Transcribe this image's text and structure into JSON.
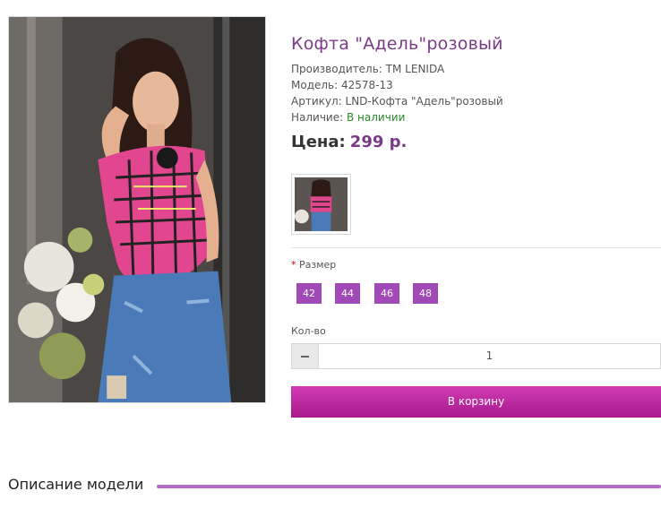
{
  "product": {
    "title": "Кофта \"Адель\"розовый",
    "manufacturer_label": "Производитель:",
    "manufacturer_value": "TM LENIDA",
    "model_label": "Модель:",
    "model_value": "42578-13",
    "sku_label": "Артикул:",
    "sku_value": "LND-Кофта \"Адель\"розовый",
    "availability_label": "Наличие:",
    "availability_value": "В наличии",
    "price_label": "Цена:",
    "price_value": "299 р."
  },
  "options": {
    "size_required_mark": "*",
    "size_label": "Размер",
    "sizes": [
      "42",
      "44",
      "46",
      "48"
    ]
  },
  "quantity": {
    "label": "Кол-во",
    "value": "1"
  },
  "cart": {
    "button_label": "В корзину"
  },
  "description": {
    "heading": "Описание модели"
  },
  "colors": {
    "accent": "#a149b7",
    "title": "#7a3a86",
    "cart_button": "#c02aa4",
    "in_stock": "#2a8a2a"
  }
}
